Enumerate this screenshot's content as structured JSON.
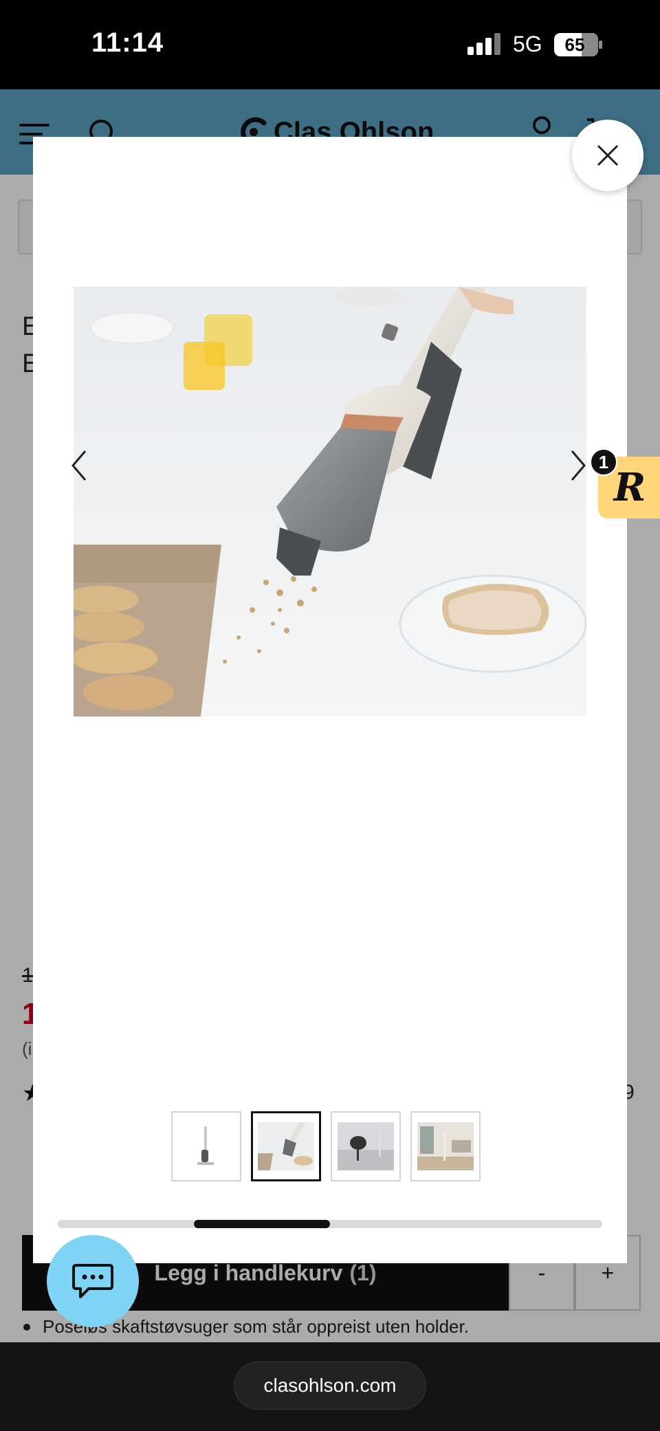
{
  "status_bar": {
    "time": "11:14",
    "network": "5G",
    "battery": "65"
  },
  "header": {
    "logo_text": "Clas Ohlson"
  },
  "background_page": {
    "title_partial": "E\nE",
    "old_price_partial": "1",
    "price_partial": "1",
    "price_note_partial": "(i",
    "rating_count_partial": "9",
    "add_to_cart": {
      "label": "Legg i handlekurv",
      "count": "(1)"
    },
    "qty_minus": "-",
    "qty_plus": "+",
    "bullet_text": "Poseløs skaftstøvsuger som står oppreist uten holder."
  },
  "gallery": {
    "current_index": 2,
    "thumbnail_count": 4,
    "scroll_position": 0.25,
    "scroll_fraction": 0.25
  },
  "r_badge": {
    "letter": "R",
    "count": "1"
  },
  "browser": {
    "url": "clasohlson.com"
  },
  "colors": {
    "header": "#5ba5c4",
    "chat": "#7fd3f4",
    "badge": "#ffd67a",
    "price": "#d0021b"
  }
}
